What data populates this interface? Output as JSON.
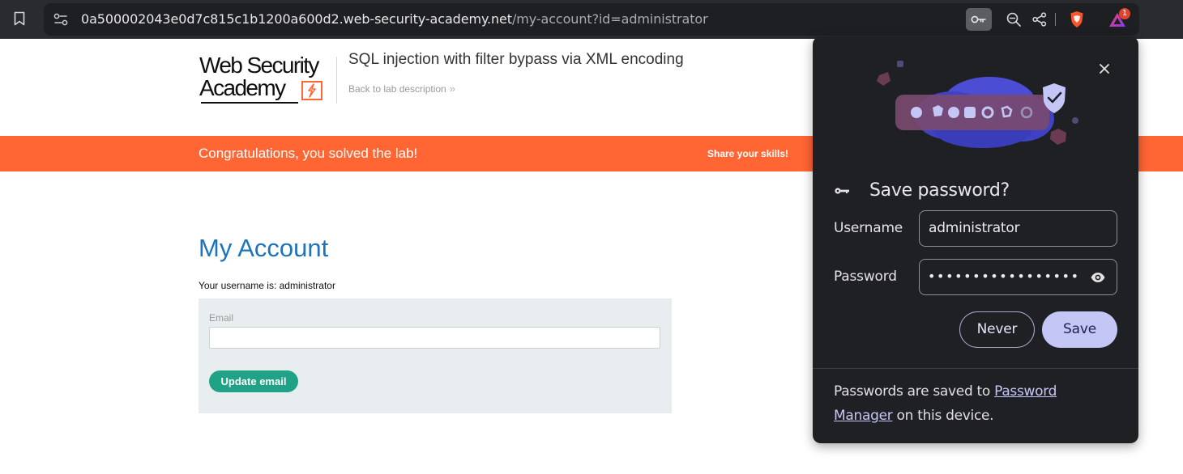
{
  "browser": {
    "url_host": "0a500002043e0d7c815c1b1200a600d2.web-security-academy.net",
    "url_path": "/my-account?id=administrator",
    "rewards_badge": "1",
    "icons": {
      "bookmark": "bookmark-icon",
      "site_settings": "site-settings-icon",
      "password_key": "key-icon",
      "zoom": "zoom-out-icon",
      "share": "share-icon",
      "brave": "brave-shields-icon",
      "rewards": "brave-rewards-icon"
    }
  },
  "header": {
    "logo_line1": "Web Security",
    "logo_line2": "Academy",
    "lab_title": "SQL injection with filter bypass via XML encoding",
    "back_link": "Back to lab description",
    "back_chevron": "»"
  },
  "banner": {
    "message": "Congratulations, you solved the lab!",
    "share": "Share your skills!",
    "color": "#ff6633"
  },
  "account": {
    "title": "My Account",
    "username_text": "Your username is: administrator",
    "email_label": "Email",
    "email_value": "",
    "update_button": "Update email"
  },
  "popup": {
    "title": "Save password?",
    "username_label": "Username",
    "username_value": "administrator",
    "password_label": "Password",
    "password_masked": "•••••••••••••••••",
    "never_button": "Never",
    "save_button": "Save",
    "footer_prefix": "Passwords are saved to ",
    "footer_link": "Password Manager",
    "footer_suffix": " on this device.",
    "accent_color": "#c4c7f6"
  }
}
